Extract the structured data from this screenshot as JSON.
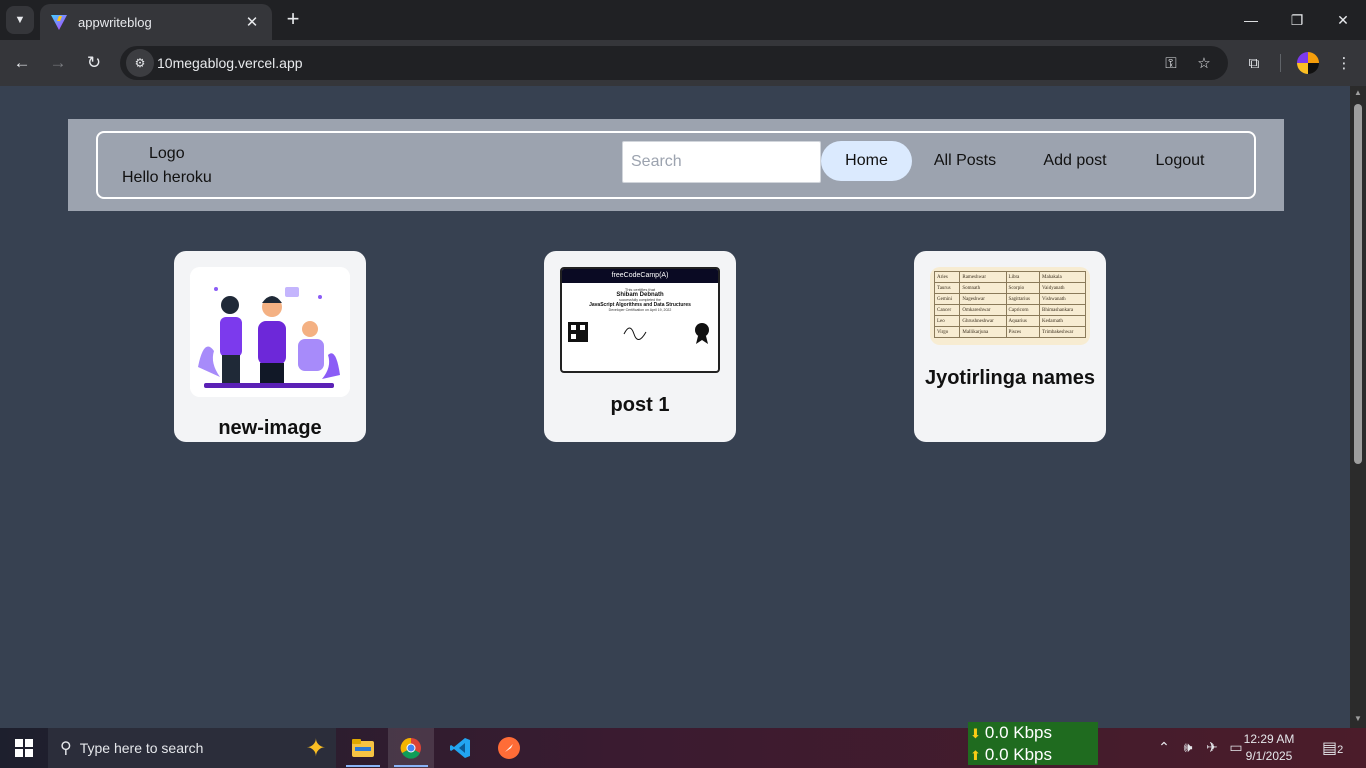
{
  "browser": {
    "tab_title": "appwriteblog",
    "tab_close": "✕",
    "new_tab": "+",
    "url": "10megablog.vercel.app",
    "window_controls": {
      "minimize": "—",
      "restore": "❐",
      "close": "✕"
    }
  },
  "header": {
    "logo": "Logo",
    "greeting": "Hello heroku",
    "search_placeholder": "Search",
    "nav": [
      {
        "label": "Home",
        "active": true
      },
      {
        "label": "All Posts",
        "active": false
      },
      {
        "label": "Add post",
        "active": false
      },
      {
        "label": "Logout",
        "active": false
      }
    ]
  },
  "posts": [
    {
      "title": "new-image"
    },
    {
      "title": "post 1",
      "certificate": {
        "brand": "freeCodeCamp(A)",
        "line1": "This certifies that",
        "name": "Shibam Debnath",
        "line2": "successfully completed the",
        "course": "JavaScript Algorithms and Data Structures",
        "line3": "Developer Certification on April 19, 2022"
      }
    },
    {
      "title": "Jyotirlinga names",
      "table": [
        [
          "Aries",
          "Rameshwar",
          "Libra",
          "Mahakala"
        ],
        [
          "Taurus",
          "Somnath",
          "Scorpio",
          "Vaidyanath"
        ],
        [
          "Gemini",
          "Nageshwar",
          "Sagittarius",
          "Vishwanath"
        ],
        [
          "Cancer",
          "Omkareshwar",
          "Capricorn",
          "Bhimashankara"
        ],
        [
          "Leo",
          "Ghrushneshwar",
          "Aquarius",
          "Kedarnath"
        ],
        [
          "Virgo",
          "Mallikarjuna",
          "Pisces",
          "Trimbakeshwar"
        ]
      ]
    }
  ],
  "taskbar": {
    "search_placeholder": "Type here to search",
    "net_down": "0.0 Kbps",
    "net_up": "0.0 Kbps",
    "time": "12:29 AM",
    "date": "9/1/2025",
    "notifications": "2"
  }
}
